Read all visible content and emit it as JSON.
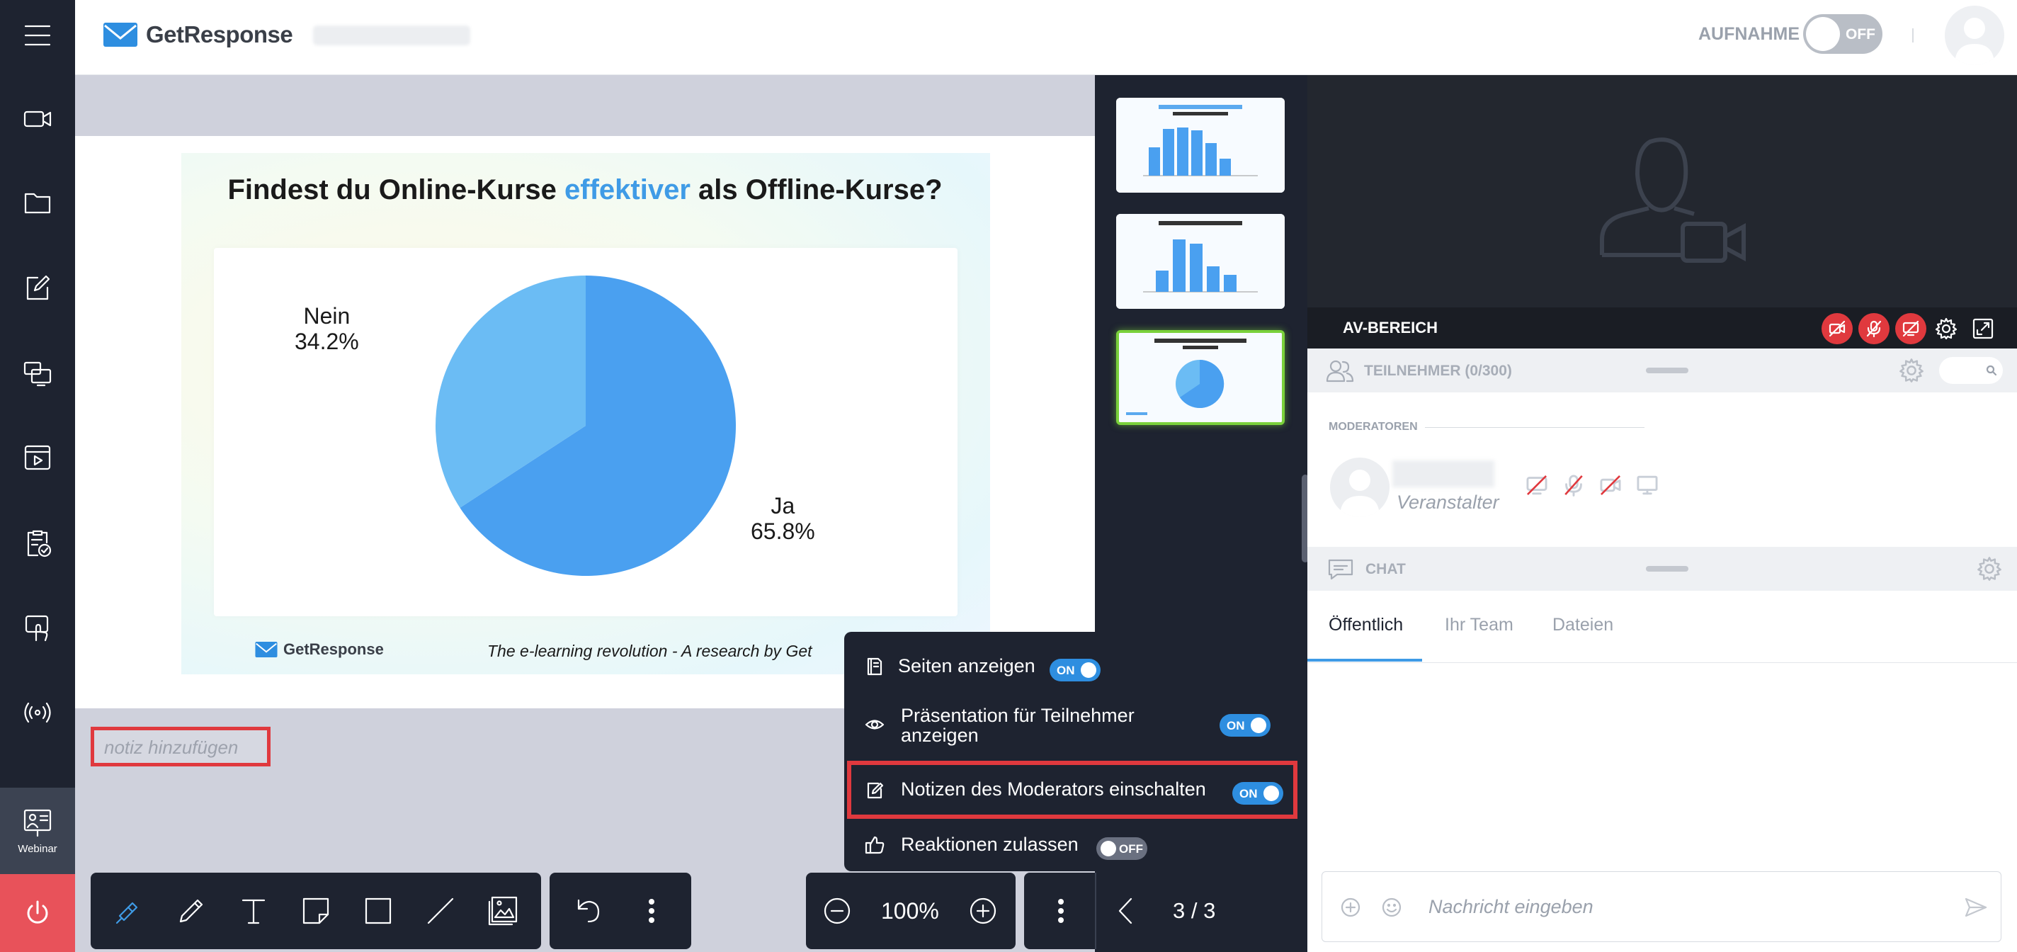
{
  "header": {
    "brand": "GetResponse",
    "recording_label": "AUFNAHME",
    "recording_state": "OFF"
  },
  "sidebar": {
    "items": [
      {
        "icon": "menu-icon"
      },
      {
        "icon": "camera-icon"
      },
      {
        "icon": "folder-icon"
      },
      {
        "icon": "edit-icon"
      },
      {
        "icon": "screen-share-icon"
      },
      {
        "icon": "video-player-icon"
      },
      {
        "icon": "clipboard-check-icon"
      },
      {
        "icon": "touch-screen-icon"
      },
      {
        "icon": "broadcast-icon"
      }
    ],
    "active_label": "Webinar"
  },
  "slide": {
    "title_part1": "Findest  du Online-Kurse ",
    "title_highlight": "effektiver",
    "title_part2": " als Offline-Kurse?",
    "footer_logo": "GetResponse",
    "footer_text": "The e-learning revolution - A research by Get"
  },
  "chart_data": {
    "type": "pie",
    "categories": [
      "Ja",
      "Nein"
    ],
    "values": [
      65.8,
      34.2
    ],
    "labels": [
      "Ja\n65.8%",
      "Nein\n34.2%"
    ],
    "colors": [
      "#4aa0f0",
      "#6bbcf4"
    ]
  },
  "note": {
    "placeholder": "notiz hinzufügen"
  },
  "thumbnails": {
    "count": 3,
    "selected": 3
  },
  "av": {
    "title": "AV-BEREICH"
  },
  "participants": {
    "label": "TEILNEHMER (0/300)",
    "moderators_label": "MODERATOREN",
    "moderator_role": "Veranstalter"
  },
  "chat": {
    "label": "CHAT",
    "tabs": [
      "Öffentlich",
      "Ihr Team",
      "Dateien"
    ],
    "active_tab": 0,
    "input_placeholder": "Nachricht eingeben"
  },
  "toolbar": {
    "zoom": "100%",
    "page": "3 / 3"
  },
  "popup": {
    "items": [
      {
        "label": "Seiten anzeigen",
        "state": "ON"
      },
      {
        "label": "Präsentation für Teilnehmer anzeigen",
        "state": "ON"
      },
      {
        "label": "Notizen des Moderators einschalten",
        "state": "ON"
      },
      {
        "label": "Reaktionen zulassen",
        "state": "OFF"
      }
    ]
  }
}
